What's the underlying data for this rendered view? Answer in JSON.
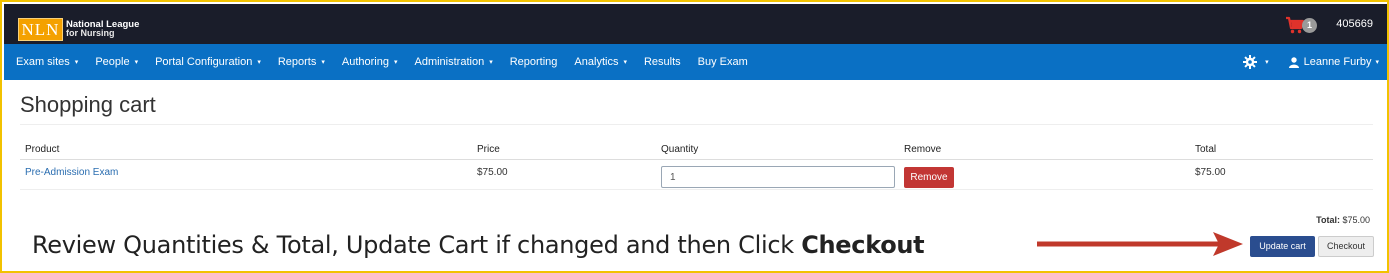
{
  "header": {
    "logo_mark": "NLN",
    "logo_line1": "National League",
    "logo_line2": "for Nursing",
    "cart_count": "1",
    "account_number": "405669"
  },
  "nav": {
    "items": [
      {
        "label": "Exam sites",
        "dropdown": true
      },
      {
        "label": "People",
        "dropdown": true
      },
      {
        "label": "Portal Configuration",
        "dropdown": true
      },
      {
        "label": "Reports",
        "dropdown": true
      },
      {
        "label": "Authoring",
        "dropdown": true
      },
      {
        "label": "Administration",
        "dropdown": true
      },
      {
        "label": "Reporting",
        "dropdown": false
      },
      {
        "label": "Analytics",
        "dropdown": true
      },
      {
        "label": "Results",
        "dropdown": false
      },
      {
        "label": "Buy Exam",
        "dropdown": false
      }
    ],
    "caret": "▾",
    "user_name": "Leanne Furby"
  },
  "page": {
    "title": "Shopping cart"
  },
  "cart": {
    "columns": {
      "product": "Product",
      "price": "Price",
      "quantity": "Quantity",
      "remove": "Remove",
      "total": "Total"
    },
    "items": [
      {
        "product": "Pre-Admission Exam",
        "price": "$75.00",
        "quantity": "1",
        "remove_label": "Remove",
        "total": "$75.00"
      }
    ],
    "grand_total_label": "Total:",
    "grand_total_value": "$75.00",
    "update_label": "Update cart",
    "checkout_label": "Checkout"
  },
  "annotation": {
    "text": "Review Quantities & Total, Update Cart if changed and then Click",
    "emphasis": "Checkout"
  },
  "colors": {
    "frame_border": "#f2c200",
    "topbar": "#1a1d2a",
    "navbar": "#0a70c4",
    "cart_icon": "#e0322b",
    "remove_button": "#c23634",
    "update_button": "#2a4d8f",
    "arrow": "#c0392b"
  },
  "icons": {
    "cart": "shopping-cart-icon",
    "settings": "gear-icon",
    "user": "user-icon",
    "arrow": "right-arrow-icon"
  }
}
